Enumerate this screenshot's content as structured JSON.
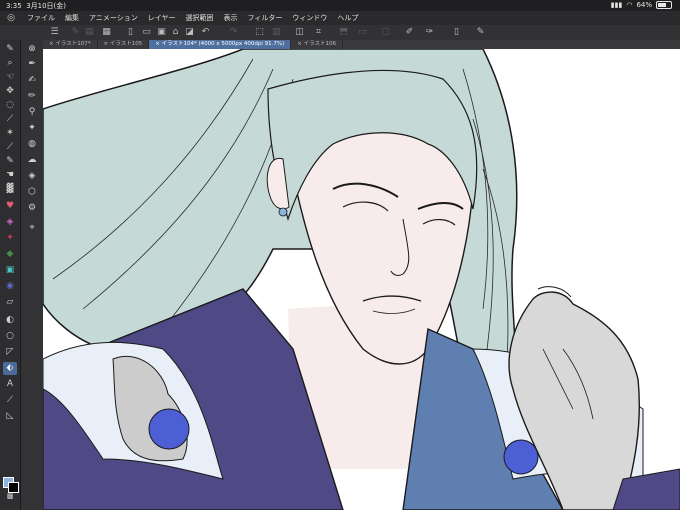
{
  "status": {
    "time": "3:35",
    "date": "3月10日(金)",
    "battery": "64%",
    "battery_level": 0.64
  },
  "menu": {
    "items": [
      "ファイル",
      "編集",
      "アニメーション",
      "レイヤー",
      "選択範囲",
      "表示",
      "フィルター",
      "ウィンドウ",
      "ヘルプ"
    ]
  },
  "tabs": [
    {
      "label": "× イラスト107*"
    },
    {
      "label": "× イラスト105"
    },
    {
      "label": "× イラスト104* (4000 x 5000px 400dpi 91.7%)"
    },
    {
      "label": "× イラスト106"
    }
  ],
  "colors": {
    "accent": "#4f6f9e",
    "main_color": "#8fb4e0",
    "sub_color": "#000000",
    "hair": "#c5d9d6",
    "skin": "#f7eceb",
    "coat": "#4f4a86"
  }
}
